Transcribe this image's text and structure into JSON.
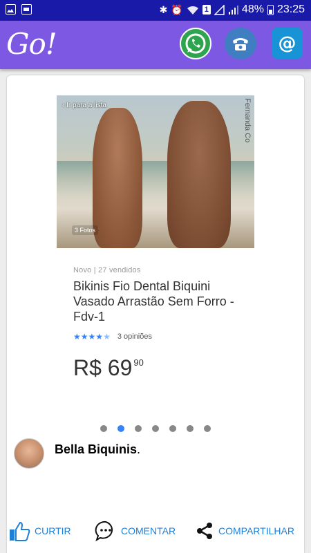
{
  "status_bar": {
    "battery": "48%",
    "time": "23:25",
    "badge": "1"
  },
  "app_bar": {
    "logo": "Go!",
    "icons": [
      "whatsapp-icon",
      "phone-icon",
      "email-icon"
    ]
  },
  "post": {
    "image": {
      "back_text": "‹ Ir para a lista",
      "photo_count": "3 Fotos",
      "watermark": "Fernanda Co"
    },
    "product": {
      "meta": "Novo   |   27 vendidos",
      "title": "Bikinis Fio Dental Biquini Vasado Arrastão Sem Forro - Fdv-1",
      "rating_text": "3 opiniões",
      "stars": 4.5,
      "price_main": "R$ 69",
      "price_cents": "90"
    },
    "carousel": {
      "total": 7,
      "active_index": 1
    },
    "page_name": "Bella Biquinis",
    "page_name_suffix": "."
  },
  "actions": {
    "like": "CURTIR",
    "comment": "COMENTAR",
    "share": "COMPARTILHAR"
  },
  "colors": {
    "status_bar": "#1a1aa8",
    "app_bar": "#7d58e3",
    "accent": "#1e7fd6",
    "carousel_active": "#3483fa"
  }
}
